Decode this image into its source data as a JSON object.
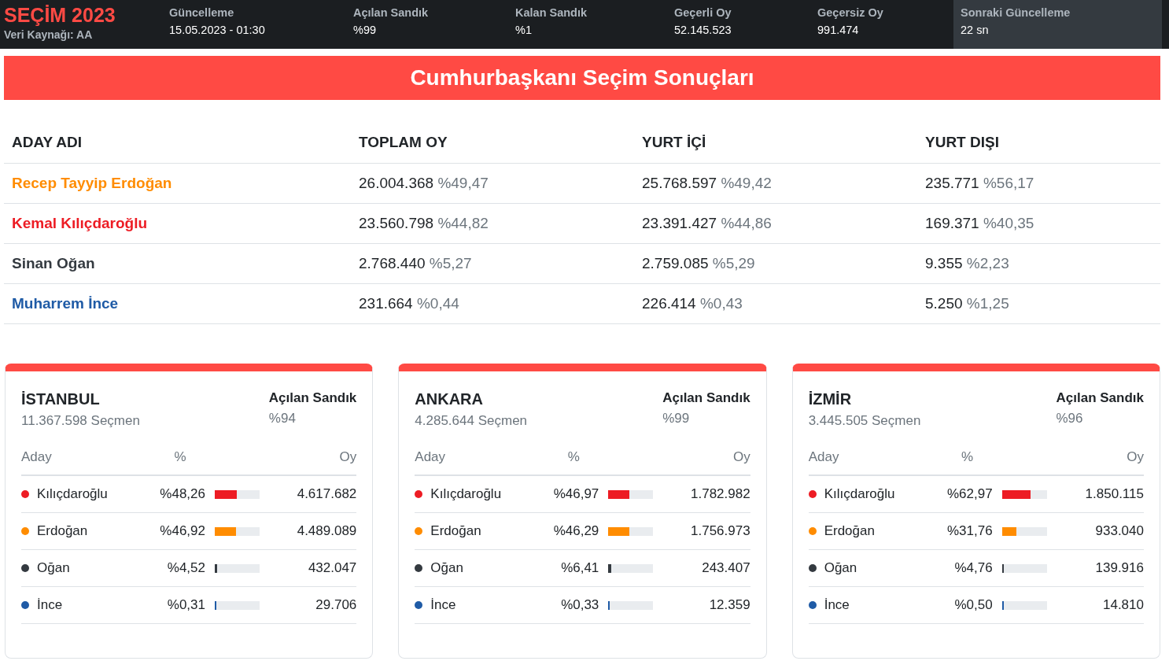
{
  "header": {
    "logo": "SEÇİM 2023",
    "source": "Veri Kaynağı: AA",
    "stats": [
      {
        "label": "Güncelleme",
        "value": "15.05.2023 - 01:30",
        "highlighted": false
      },
      {
        "label": "Açılan Sandık",
        "value": "%99",
        "highlighted": false
      },
      {
        "label": "Kalan Sandık",
        "value": "%1",
        "highlighted": false
      },
      {
        "label": "Geçerli Oy",
        "value": "52.145.523",
        "highlighted": false
      },
      {
        "label": "Geçersiz Oy",
        "value": "991.474",
        "highlighted": false
      },
      {
        "label": "Sonraki Güncelleme",
        "value": "22 sn",
        "highlighted": true
      }
    ]
  },
  "banner": {
    "title": "Cumhurbaşkanı Seçim Sonuçları"
  },
  "results_table": {
    "columns": [
      "ADAY ADI",
      "TOPLAM OY",
      "YURT İÇİ",
      "YURT DIŞI"
    ],
    "rows": [
      {
        "color": "#ff8c00",
        "cells": [
          {
            "name": "Recep Tayyip Erdoğan"
          },
          {
            "votes": "26.004.368",
            "percent": "%49,47"
          },
          {
            "votes": "25.768.597",
            "percent": "%49,42"
          },
          {
            "votes": "235.771",
            "percent": "%56,17"
          }
        ]
      },
      {
        "color": "#ed1c24",
        "cells": [
          {
            "name": "Kemal Kılıçdaroğlu"
          },
          {
            "votes": "23.560.798",
            "percent": "%44,82"
          },
          {
            "votes": "23.391.427",
            "percent": "%44,86"
          },
          {
            "votes": "169.371",
            "percent": "%40,35"
          }
        ]
      },
      {
        "color": "#343a40",
        "cells": [
          {
            "name": "Sinan Oğan"
          },
          {
            "votes": "2.768.440",
            "percent": "%5,27"
          },
          {
            "votes": "2.759.085",
            "percent": "%5,29"
          },
          {
            "votes": "9.355",
            "percent": "%2,23"
          }
        ]
      },
      {
        "color": "#1f5ba6",
        "cells": [
          {
            "name": "Muharrem İnce"
          },
          {
            "votes": "231.664",
            "percent": "%0,44"
          },
          {
            "votes": "226.414",
            "percent": "%0,43"
          },
          {
            "votes": "5.250",
            "percent": "%1,25"
          }
        ]
      }
    ]
  },
  "cities": [
    {
      "name": "İSTANBUL",
      "voters": "11.367.598 Seçmen",
      "opened_label": "Açılan Sandık",
      "opened": "%94",
      "columns": [
        "Aday",
        "%",
        "Oy"
      ],
      "rows": [
        {
          "name": "Kılıçdaroğlu",
          "color": "#ed1c24",
          "percent": "%48,26",
          "level": 0.4826,
          "votes": "4.617.682"
        },
        {
          "name": "Erdoğan",
          "color": "#ff8c00",
          "percent": "%46,92",
          "level": 0.4692,
          "votes": "4.489.089"
        },
        {
          "name": "Oğan",
          "color": "#343a40",
          "percent": "%4,52",
          "level": 0.0452,
          "votes": "432.047"
        },
        {
          "name": "İnce",
          "color": "#1f5ba6",
          "percent": "%0,31",
          "level": 0.0031,
          "votes": "29.706"
        }
      ]
    },
    {
      "name": "ANKARA",
      "voters": "4.285.644 Seçmen",
      "opened_label": "Açılan Sandık",
      "opened": "%99",
      "columns": [
        "Aday",
        "%",
        "Oy"
      ],
      "rows": [
        {
          "name": "Kılıçdaroğlu",
          "color": "#ed1c24",
          "percent": "%46,97",
          "level": 0.4697,
          "votes": "1.782.982"
        },
        {
          "name": "Erdoğan",
          "color": "#ff8c00",
          "percent": "%46,29",
          "level": 0.4629,
          "votes": "1.756.973"
        },
        {
          "name": "Oğan",
          "color": "#343a40",
          "percent": "%6,41",
          "level": 0.0641,
          "votes": "243.407"
        },
        {
          "name": "İnce",
          "color": "#1f5ba6",
          "percent": "%0,33",
          "level": 0.0033,
          "votes": "12.359"
        }
      ]
    },
    {
      "name": "İZMİR",
      "voters": "3.445.505 Seçmen",
      "opened_label": "Açılan Sandık",
      "opened": "%96",
      "columns": [
        "Aday",
        "%",
        "Oy"
      ],
      "rows": [
        {
          "name": "Kılıçdaroğlu",
          "color": "#ed1c24",
          "percent": "%62,97",
          "level": 0.6297,
          "votes": "1.850.115"
        },
        {
          "name": "Erdoğan",
          "color": "#ff8c00",
          "percent": "%31,76",
          "level": 0.3176,
          "votes": "933.040"
        },
        {
          "name": "Oğan",
          "color": "#343a40",
          "percent": "%4,76",
          "level": 0.0476,
          "votes": "139.916"
        },
        {
          "name": "İnce",
          "color": "#1f5ba6",
          "percent": "%0,50",
          "level": 0.005,
          "votes": "14.810"
        }
      ]
    }
  ]
}
